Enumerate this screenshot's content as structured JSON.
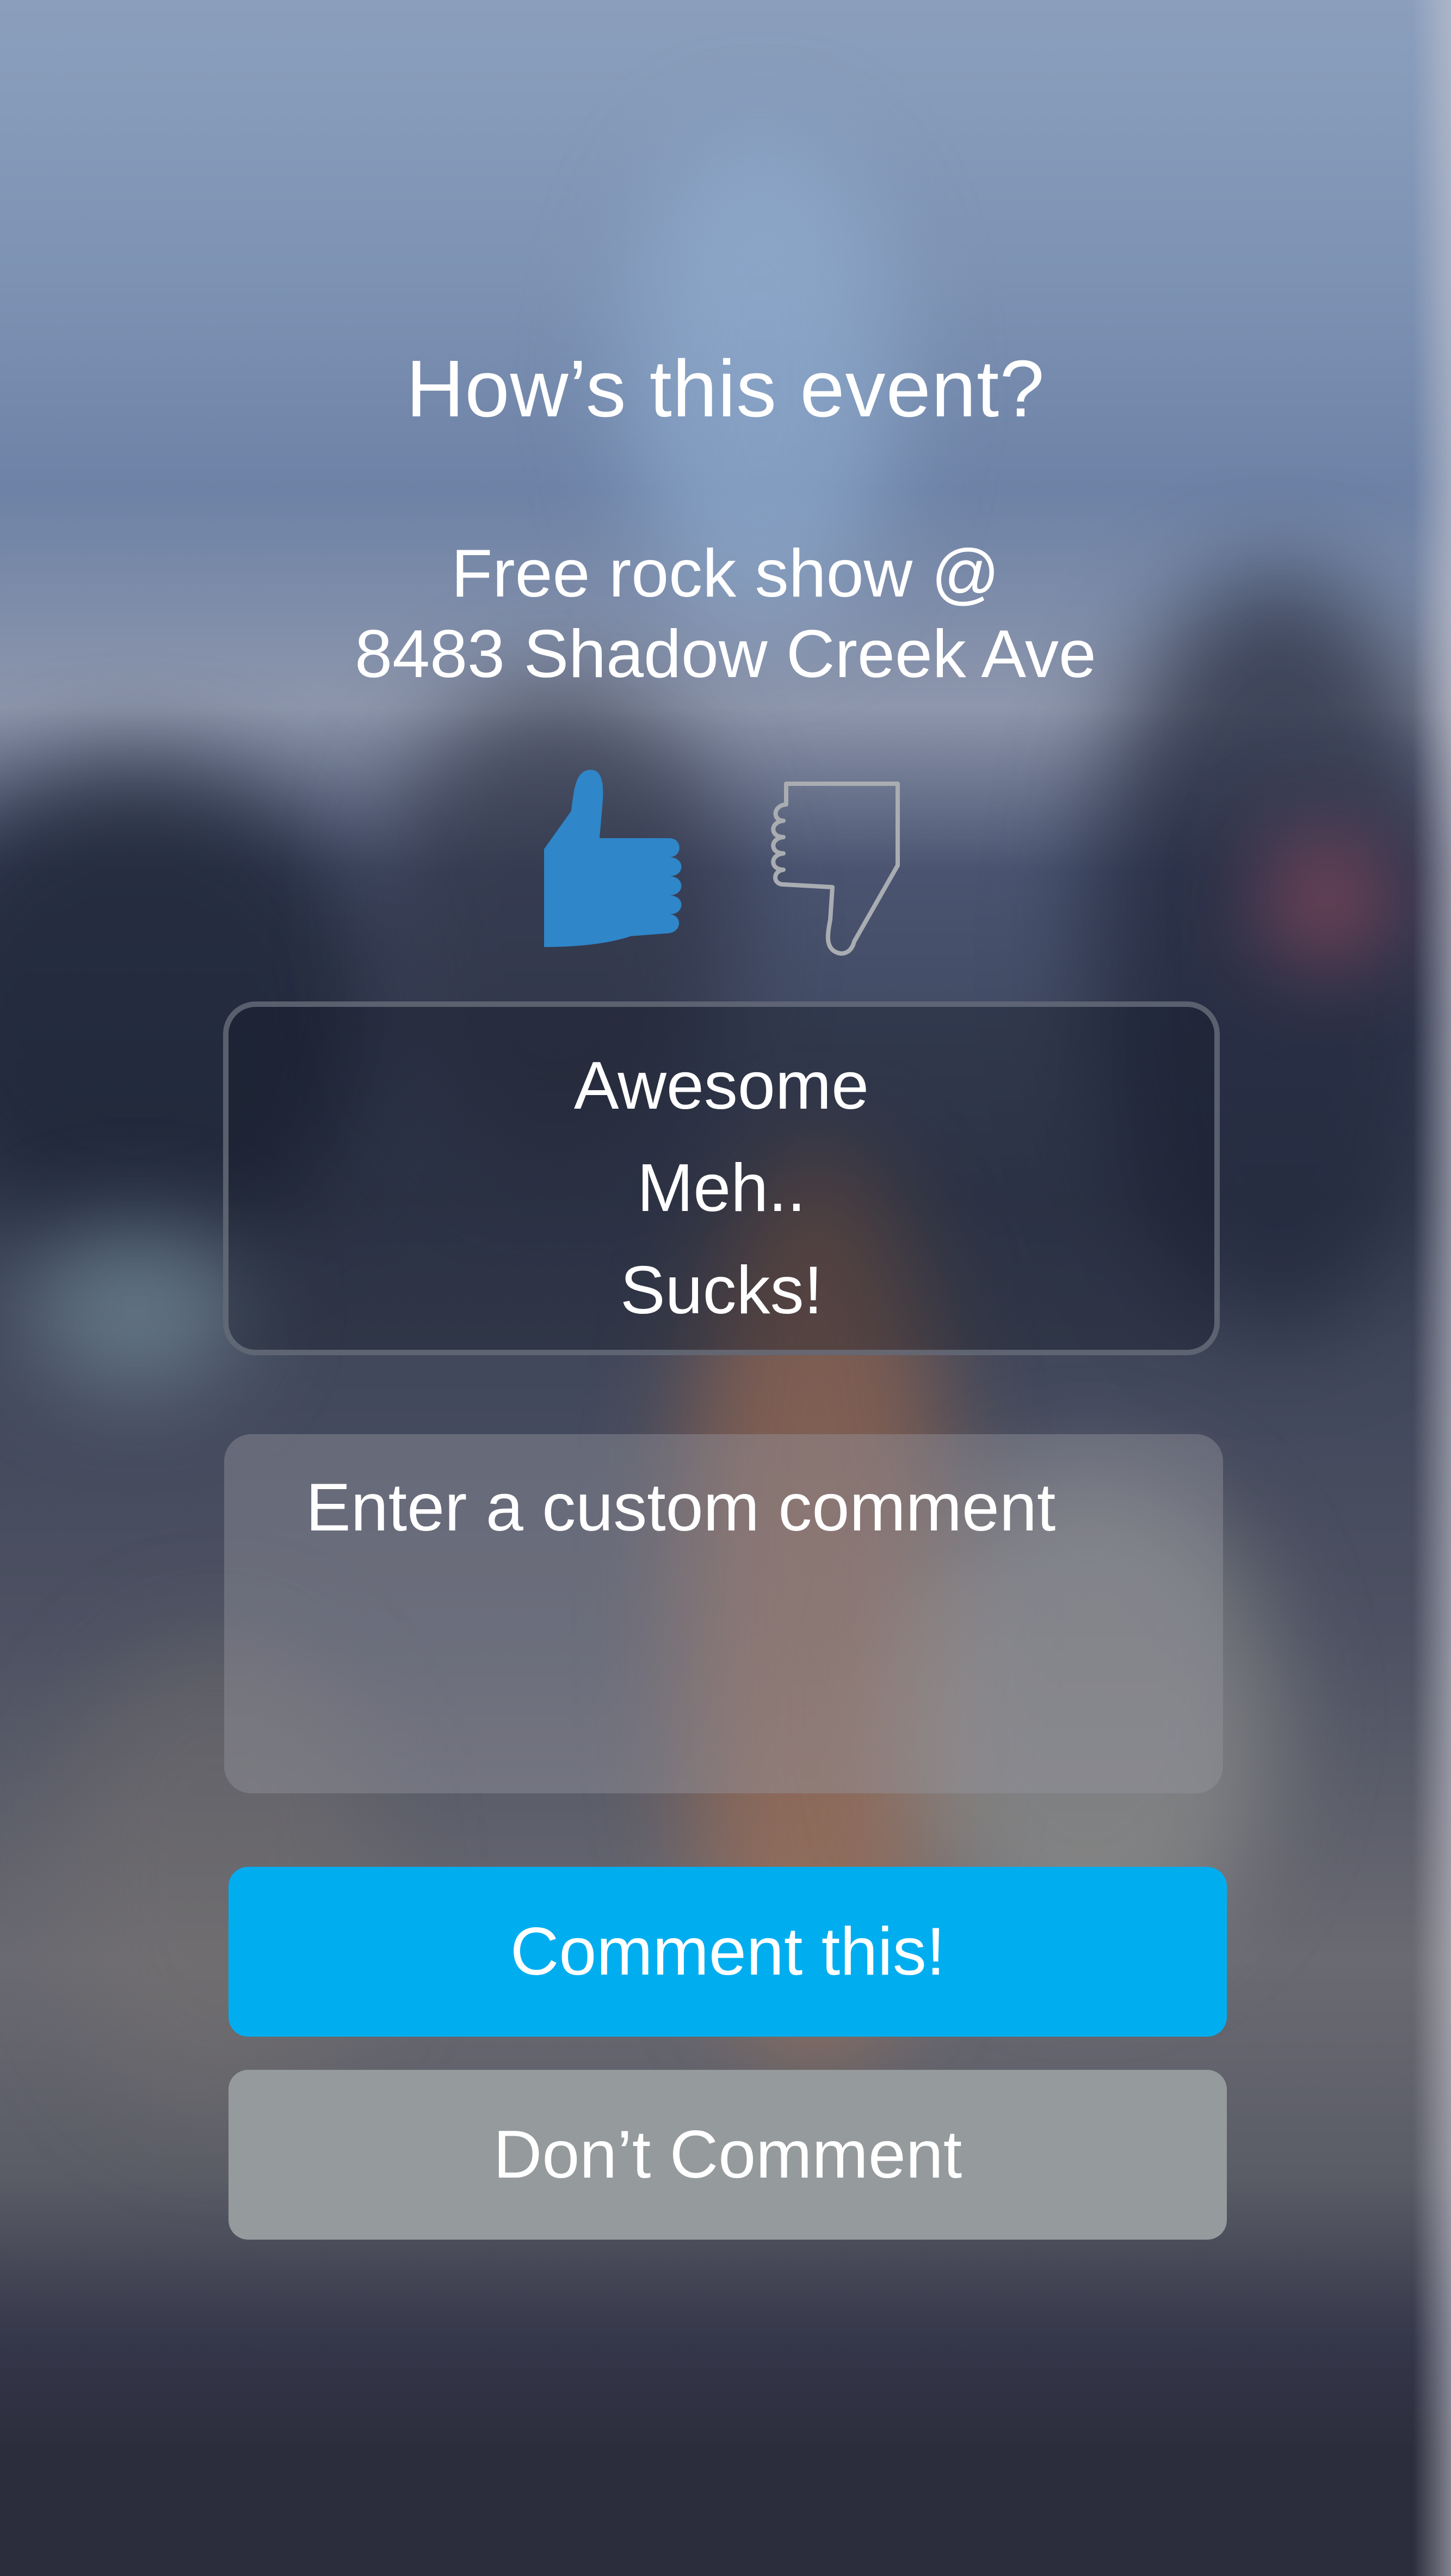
{
  "header": {
    "title": "How’s this event?"
  },
  "event": {
    "line1": "Free rock show @",
    "line2": "8483 Shadow Creek Ave"
  },
  "rating": {
    "selected": "thumbs-up",
    "up_color": "#2f86c9",
    "down_color": "#a9adb2"
  },
  "quick_options": [
    {
      "label": "Awesome"
    },
    {
      "label": "Meh.."
    },
    {
      "label": "Sucks!"
    }
  ],
  "comment": {
    "value": "",
    "placeholder": "Enter a custom comment"
  },
  "actions": {
    "primary_label": "Comment this!",
    "secondary_label": "Don’t Comment",
    "primary_color": "#00aeef",
    "secondary_color": "#959a9c"
  }
}
